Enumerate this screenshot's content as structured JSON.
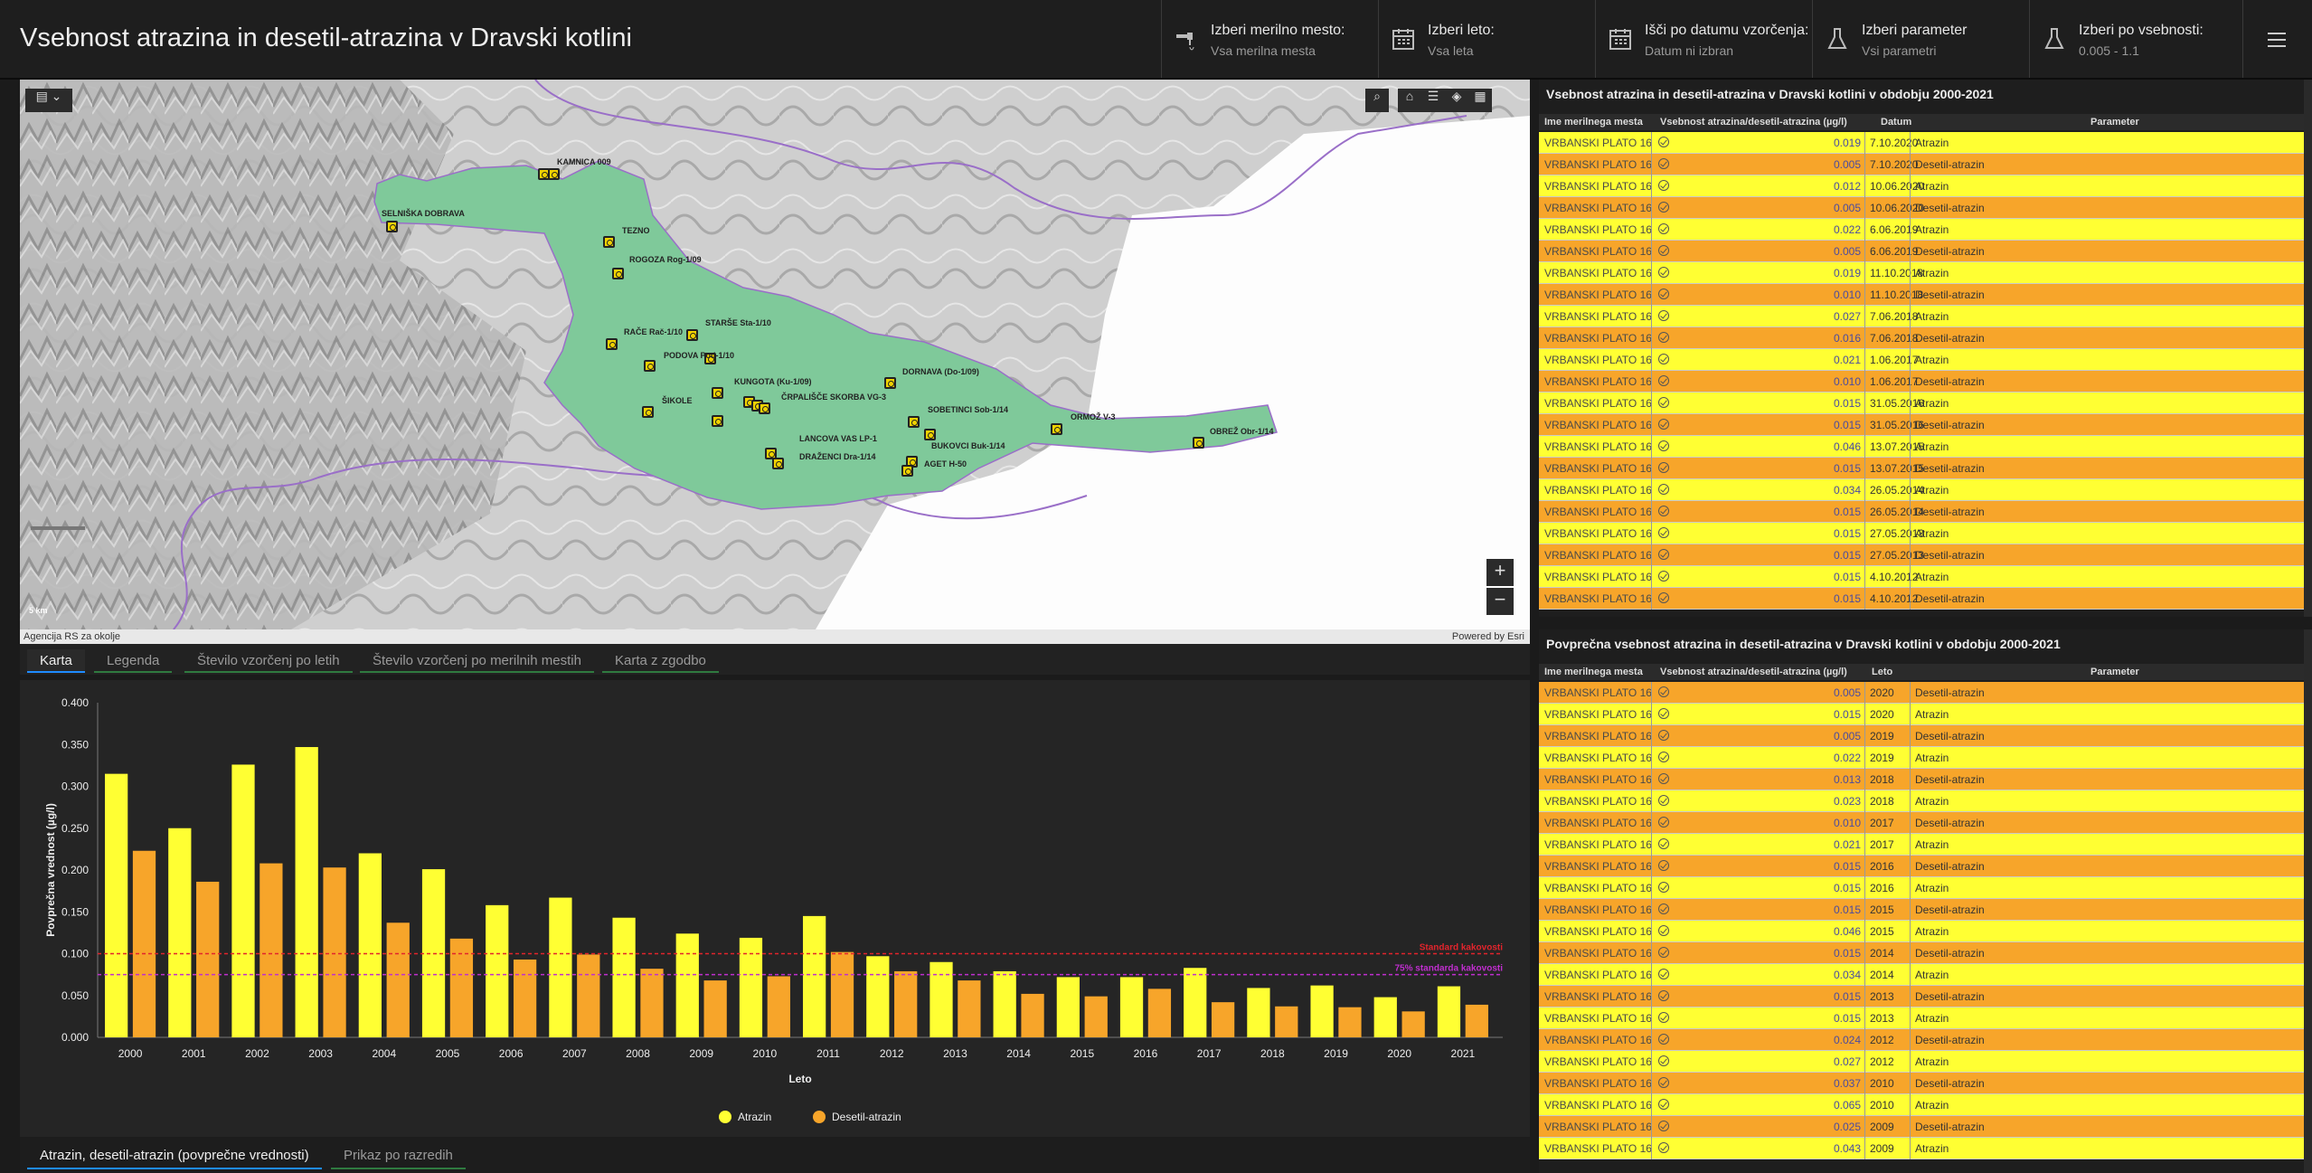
{
  "header": {
    "title": "Vsebnost atrazina in desetil-atrazina v Dravski kotlini",
    "selectors": [
      {
        "label": "Izberi merilno mesto:",
        "value": "Vsa merilna mesta",
        "icon": "tap-icon"
      },
      {
        "label": "Izberi leto:",
        "value": "Vsa leta",
        "icon": "calendar-icon"
      },
      {
        "label": "Išči po datumu vzorčenja:",
        "value": "Datum ni izbran",
        "icon": "calendar-icon"
      },
      {
        "label": "Izberi parameter",
        "value": "Vsi parametri",
        "icon": "flask-icon"
      },
      {
        "label": "Izberi po vsebnosti:",
        "value": "0.005 - 1.1",
        "icon": "flask-icon"
      }
    ],
    "menu_icon": "hamburger-icon"
  },
  "map": {
    "attribution_left": "Agencija RS za okolje",
    "attribution_right": "Powered by Esri",
    "scale_label": "5 km",
    "zoom_in": "+",
    "zoom_out": "−",
    "station_labels": [
      "KAMNICA 009",
      "SELNIŠKA DOBRAVA",
      "TEZNO",
      "ROGOZA Rog-1/09",
      "STARŠE Sta-1/10",
      "RAČE Rač-1/10",
      "PODOVA Pod-1/10",
      "KUNGOTA (Ku-1/09)",
      "ČRPALIŠČE SKORBA VG-3",
      "DORNAVA (Do-1/09)",
      "ŠIKOLE",
      "SOBETINCI Sob-1/14",
      "ORMOŽ V-3",
      "OBREŽ Obr-1/14",
      "LANCOVA VAS LP-1",
      "BUKOVCI Buk-1/14",
      "DRAŽENCI Dra-1/14",
      "AGET H-50"
    ]
  },
  "tabs": [
    "Karta",
    "Legenda",
    "Število vzorčenj po letih",
    "Število vzorčenj po merilnih mestih",
    "Karta z zgodbo"
  ],
  "bottom_tabs": [
    "Atrazin, desetil-atrazin (povprečne vrednosti)",
    "Prikaz po razredih"
  ],
  "colors": {
    "atrazin": "#ffff33",
    "desetil": "#f7a52a",
    "standard": "#e2242c",
    "standard75": "#c02ecf",
    "row_yellow": "#ffff33",
    "row_orange": "#f7a52a"
  },
  "chart_data": {
    "type": "bar",
    "categories": [
      "2000",
      "2001",
      "2002",
      "2003",
      "2004",
      "2005",
      "2006",
      "2007",
      "2008",
      "2009",
      "2010",
      "2011",
      "2012",
      "2013",
      "2014",
      "2015",
      "2016",
      "2017",
      "2018",
      "2019",
      "2020",
      "2021"
    ],
    "series": [
      {
        "name": "Atrazin",
        "values": [
          0.315,
          0.25,
          0.326,
          0.347,
          0.22,
          0.201,
          0.158,
          0.167,
          0.143,
          0.124,
          0.119,
          0.145,
          0.097,
          0.09,
          0.079,
          0.072,
          0.072,
          0.083,
          0.059,
          0.062,
          0.048,
          0.061
        ]
      },
      {
        "name": "Desetil-atrazin",
        "values": [
          0.223,
          0.186,
          0.208,
          0.203,
          0.137,
          0.118,
          0.093,
          0.099,
          0.082,
          0.068,
          0.073,
          0.102,
          0.079,
          0.068,
          0.052,
          0.049,
          0.058,
          0.042,
          0.037,
          0.036,
          0.031,
          0.039
        ]
      }
    ],
    "xlabel": "Leto",
    "ylabel": "Povprečna vrednost (µg/l)",
    "ylim": [
      0,
      0.4
    ],
    "yticks": [
      "0.000",
      "0.050",
      "0.100",
      "0.150",
      "0.200",
      "0.250",
      "0.300",
      "0.350",
      "0.400"
    ],
    "reference_lines": [
      {
        "label": "Standard kakovosti",
        "value": 0.1
      },
      {
        "label": "75% standarda kakovosti",
        "value": 0.075
      }
    ],
    "legend_position": "bottom"
  },
  "table1": {
    "title": "Vsebnost atrazina in desetil-atrazina v Dravski kotlini v obdobju 2000-2021",
    "columns": [
      "Ime merilnega mesta",
      "Vsebnost atrazina/desetil-atrazina (µg/l)",
      "Datum",
      "Parameter"
    ],
    "rows": [
      [
        "VRBANSKI PLATO 16",
        "0.019",
        "7.10.2020",
        "Atrazin"
      ],
      [
        "VRBANSKI PLATO 16",
        "0.005",
        "7.10.2020",
        "Desetil-atrazin"
      ],
      [
        "VRBANSKI PLATO 16",
        "0.012",
        "10.06.2020",
        "Atrazin"
      ],
      [
        "VRBANSKI PLATO 16",
        "0.005",
        "10.06.2020",
        "Desetil-atrazin"
      ],
      [
        "VRBANSKI PLATO 16",
        "0.022",
        "6.06.2019",
        "Atrazin"
      ],
      [
        "VRBANSKI PLATO 16",
        "0.005",
        "6.06.2019",
        "Desetil-atrazin"
      ],
      [
        "VRBANSKI PLATO 16",
        "0.019",
        "11.10.2018",
        "Atrazin"
      ],
      [
        "VRBANSKI PLATO 16",
        "0.010",
        "11.10.2018",
        "Desetil-atrazin"
      ],
      [
        "VRBANSKI PLATO 16",
        "0.027",
        "7.06.2018",
        "Atrazin"
      ],
      [
        "VRBANSKI PLATO 16",
        "0.016",
        "7.06.2018",
        "Desetil-atrazin"
      ],
      [
        "VRBANSKI PLATO 16",
        "0.021",
        "1.06.2017",
        "Atrazin"
      ],
      [
        "VRBANSKI PLATO 16",
        "0.010",
        "1.06.2017",
        "Desetil-atrazin"
      ],
      [
        "VRBANSKI PLATO 16",
        "0.015",
        "31.05.2016",
        "Atrazin"
      ],
      [
        "VRBANSKI PLATO 16",
        "0.015",
        "31.05.2016",
        "Desetil-atrazin"
      ],
      [
        "VRBANSKI PLATO 16",
        "0.046",
        "13.07.2015",
        "Atrazin"
      ],
      [
        "VRBANSKI PLATO 16",
        "0.015",
        "13.07.2015",
        "Desetil-atrazin"
      ],
      [
        "VRBANSKI PLATO 16",
        "0.034",
        "26.05.2014",
        "Atrazin"
      ],
      [
        "VRBANSKI PLATO 16",
        "0.015",
        "26.05.2014",
        "Desetil-atrazin"
      ],
      [
        "VRBANSKI PLATO 16",
        "0.015",
        "27.05.2013",
        "Atrazin"
      ],
      [
        "VRBANSKI PLATO 16",
        "0.015",
        "27.05.2013",
        "Desetil-atrazin"
      ],
      [
        "VRBANSKI PLATO 16",
        "0.015",
        "4.10.2012",
        "Atrazin"
      ],
      [
        "VRBANSKI PLATO 16",
        "0.015",
        "4.10.2012",
        "Desetil-atrazin"
      ]
    ]
  },
  "table2": {
    "title": "Povprečna vsebnost atrazina in desetil-atrazina v Dravski kotlini v obdobju 2000-2021",
    "columns": [
      "Ime merilnega mesta",
      "Vsebnost atrazina/desetil-atrazina (µg/l)",
      "Leto",
      "Parameter"
    ],
    "rows": [
      [
        "VRBANSKI PLATO 16",
        "0.005",
        "2020",
        "Desetil-atrazin"
      ],
      [
        "VRBANSKI PLATO 16",
        "0.015",
        "2020",
        "Atrazin"
      ],
      [
        "VRBANSKI PLATO 16",
        "0.005",
        "2019",
        "Desetil-atrazin"
      ],
      [
        "VRBANSKI PLATO 16",
        "0.022",
        "2019",
        "Atrazin"
      ],
      [
        "VRBANSKI PLATO 16",
        "0.013",
        "2018",
        "Desetil-atrazin"
      ],
      [
        "VRBANSKI PLATO 16",
        "0.023",
        "2018",
        "Atrazin"
      ],
      [
        "VRBANSKI PLATO 16",
        "0.010",
        "2017",
        "Desetil-atrazin"
      ],
      [
        "VRBANSKI PLATO 16",
        "0.021",
        "2017",
        "Atrazin"
      ],
      [
        "VRBANSKI PLATO 16",
        "0.015",
        "2016",
        "Desetil-atrazin"
      ],
      [
        "VRBANSKI PLATO 16",
        "0.015",
        "2016",
        "Atrazin"
      ],
      [
        "VRBANSKI PLATO 16",
        "0.015",
        "2015",
        "Desetil-atrazin"
      ],
      [
        "VRBANSKI PLATO 16",
        "0.046",
        "2015",
        "Atrazin"
      ],
      [
        "VRBANSKI PLATO 16",
        "0.015",
        "2014",
        "Desetil-atrazin"
      ],
      [
        "VRBANSKI PLATO 16",
        "0.034",
        "2014",
        "Atrazin"
      ],
      [
        "VRBANSKI PLATO 16",
        "0.015",
        "2013",
        "Desetil-atrazin"
      ],
      [
        "VRBANSKI PLATO 16",
        "0.015",
        "2013",
        "Atrazin"
      ],
      [
        "VRBANSKI PLATO 16",
        "0.024",
        "2012",
        "Desetil-atrazin"
      ],
      [
        "VRBANSKI PLATO 16",
        "0.027",
        "2012",
        "Atrazin"
      ],
      [
        "VRBANSKI PLATO 16",
        "0.037",
        "2010",
        "Desetil-atrazin"
      ],
      [
        "VRBANSKI PLATO 16",
        "0.065",
        "2010",
        "Atrazin"
      ],
      [
        "VRBANSKI PLATO 16",
        "0.025",
        "2009",
        "Desetil-atrazin"
      ],
      [
        "VRBANSKI PLATO 16",
        "0.043",
        "2009",
        "Atrazin"
      ]
    ]
  }
}
